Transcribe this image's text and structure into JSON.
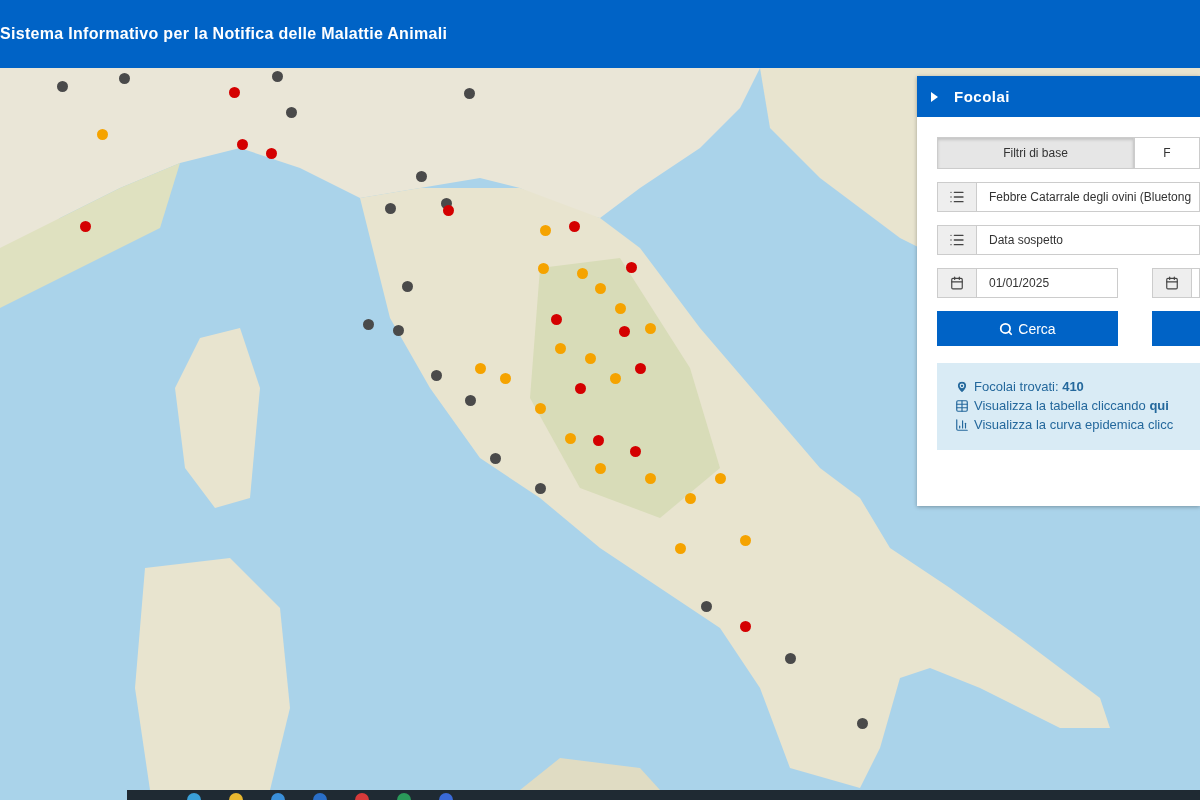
{
  "header": {
    "title": "Sistema Informativo per la Notifica delle Malattie Animali"
  },
  "map": {
    "markers": [
      {
        "color": "#4a4a4a"
      },
      {
        "color": "#4a4a4a"
      },
      {
        "color": "#4a4a4a"
      },
      {
        "color": "#4a4a4a"
      },
      {
        "color": "#4a4a4a"
      },
      {
        "color": "#4a4a4a"
      },
      {
        "color": "#4a4a4a"
      },
      {
        "color": "#4a4a4a"
      },
      {
        "color": "#4a4a4a"
      },
      {
        "color": "#4a4a4a"
      },
      {
        "color": "#4a4a4a"
      },
      {
        "color": "#4a4a4a"
      },
      {
        "color": "#4a4a4a"
      },
      {
        "color": "#4a4a4a"
      },
      {
        "color": "#4a4a4a"
      },
      {
        "color": "#4a4a4a"
      },
      {
        "color": "#4a4a4a"
      },
      {
        "color": "#4a4a4a"
      },
      {
        "color": "#d40000"
      },
      {
        "color": "#d40000"
      },
      {
        "color": "#d40000"
      },
      {
        "color": "#d40000"
      },
      {
        "color": "#d40000"
      },
      {
        "color": "#d40000"
      },
      {
        "color": "#d40000"
      },
      {
        "color": "#d40000"
      },
      {
        "color": "#d40000"
      },
      {
        "color": "#d40000"
      },
      {
        "color": "#d40000"
      },
      {
        "color": "#d40000"
      },
      {
        "color": "#d40000"
      },
      {
        "color": "#d40000"
      },
      {
        "color": "#f5a300"
      },
      {
        "color": "#f5a300"
      },
      {
        "color": "#f5a300"
      },
      {
        "color": "#f5a300"
      },
      {
        "color": "#f5a300"
      },
      {
        "color": "#f5a300"
      },
      {
        "color": "#f5a300"
      },
      {
        "color": "#f5a300"
      },
      {
        "color": "#f5a300"
      },
      {
        "color": "#f5a300"
      },
      {
        "color": "#f5a300"
      },
      {
        "color": "#f5a300"
      },
      {
        "color": "#f5a300"
      },
      {
        "color": "#f5a300"
      },
      {
        "color": "#f5a300"
      },
      {
        "color": "#f5a300"
      },
      {
        "color": "#f5a300"
      },
      {
        "color": "#f5a300"
      },
      {
        "color": "#f5a300"
      },
      {
        "color": "#f5a300"
      }
    ]
  },
  "panel": {
    "title": "Focolai",
    "tabs": [
      {
        "label": "Filtri di base",
        "selected": true
      },
      {
        "label": "F",
        "selected": false
      }
    ],
    "disease_select": {
      "value": "Febbre Catarrale degli ovini (Bluetong"
    },
    "date_type_select": {
      "value": "Data sospetto"
    },
    "date_from": {
      "value": "01/01/2025"
    },
    "search_button": {
      "label": "Cerca"
    },
    "info": {
      "found_label": "Focolai trovati: ",
      "found_count": "410",
      "table_link": "Visualizza la tabella cliccando **qui**",
      "curve_link": "Visualizza la curva epidemica clicc"
    }
  }
}
